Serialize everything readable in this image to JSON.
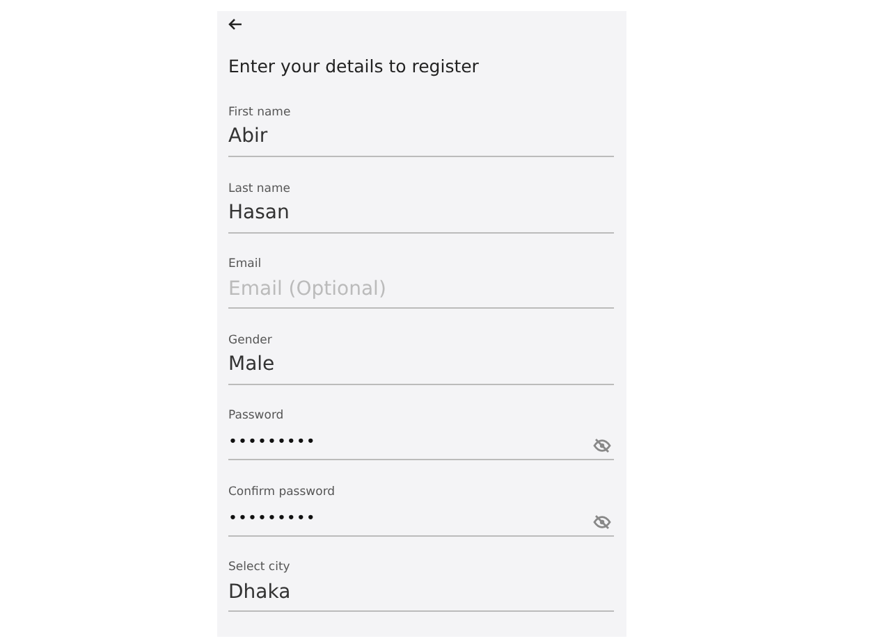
{
  "title": "Enter your details to register",
  "fields": [
    {
      "kind": "text",
      "label": "First name",
      "value": "Abir"
    },
    {
      "kind": "text",
      "label": "Last name",
      "value": "Hasan"
    },
    {
      "kind": "text",
      "label": "Email",
      "placeholder": "Email (Optional)"
    },
    {
      "kind": "text",
      "label": "Gender",
      "value": "Male"
    },
    {
      "kind": "password",
      "label": "Password",
      "value": "•••••••••"
    },
    {
      "kind": "password",
      "label": "Confirm password",
      "value": "•••••••••"
    },
    {
      "kind": "text",
      "label": "Select city",
      "value": "Dhaka"
    }
  ]
}
